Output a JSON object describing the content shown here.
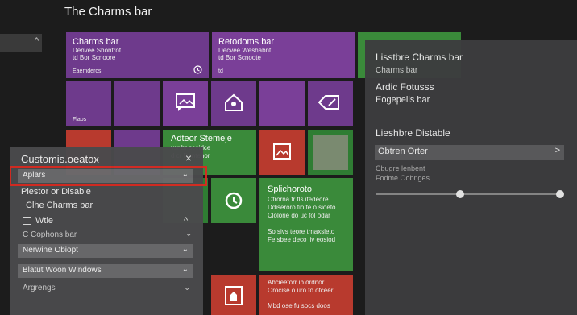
{
  "page_title": "The Charms bar",
  "left_strip": {
    "chevron": "^"
  },
  "tiles": {
    "top_left": {
      "title": "Charms bar",
      "lines": [
        "Denvee Shontrot",
        "td Bor Scnoore",
        "Eaemdercs"
      ]
    },
    "top_right": {
      "title": "Retodoms bar",
      "lines": [
        "Decvee Weshabnt",
        "td Bor Scnoote",
        "td"
      ]
    },
    "small_left": {
      "label": "Flaos"
    },
    "green_middle": {
      "title": "Adteor Stemeje",
      "lines": [
        "vsr br sceidce",
        "d cr Dontenor"
      ]
    },
    "green_big": {
      "title": "Splichoroto",
      "lines": [
        "Ofrorna tr fls itedeore",
        "Ddiseroro tio fe o sioeto",
        "Clolorie do uc fol odar",
        "So sivs teore trnaxsleto",
        "Fe sbee deco liv eosiod"
      ]
    },
    "red_bottom": {
      "lines": [
        "Abcieetorr ib ordnor",
        "Orocise o uro to ofceer",
        "Mbd ose fu socs doos"
      ]
    }
  },
  "right_panel": {
    "heading1": "Lisstbre Charms bar",
    "sub1": "Charms bar",
    "heading2": "Ardic Fotusss",
    "sub2": "Eogepells bar",
    "heading3": "Lieshbre Distable",
    "select_value": "Obtren Orter",
    "select_chevron": ">",
    "note1": "Cbugre lenbent",
    "note2": "Fodme Oobnges"
  },
  "flyout": {
    "title": "Customis.oeatox",
    "close": "×",
    "dropdown1": {
      "value": "Aplars",
      "chevron": "⌄"
    },
    "restore_label": "Plestor or Disable",
    "charms_label": "Clhe Charms bar",
    "wtle_label": "Wtle",
    "wtle_chevron": "^",
    "cophons_label": "C Cophons bar",
    "cophons_chevron": "⌄",
    "dropdown2": {
      "value": "Nerwine Obiopt",
      "chevron": "⌄"
    },
    "dropdown3": {
      "value": "Blatut Woon Windows",
      "chevron": "⌄"
    },
    "argrengs_label": "Argrengs",
    "argrengs_chevron": "⌄"
  },
  "colors": {
    "highlight": "#d62b22",
    "purple": "#6e3a8c",
    "green": "#3a8a3a",
    "red": "#b83a2e"
  }
}
